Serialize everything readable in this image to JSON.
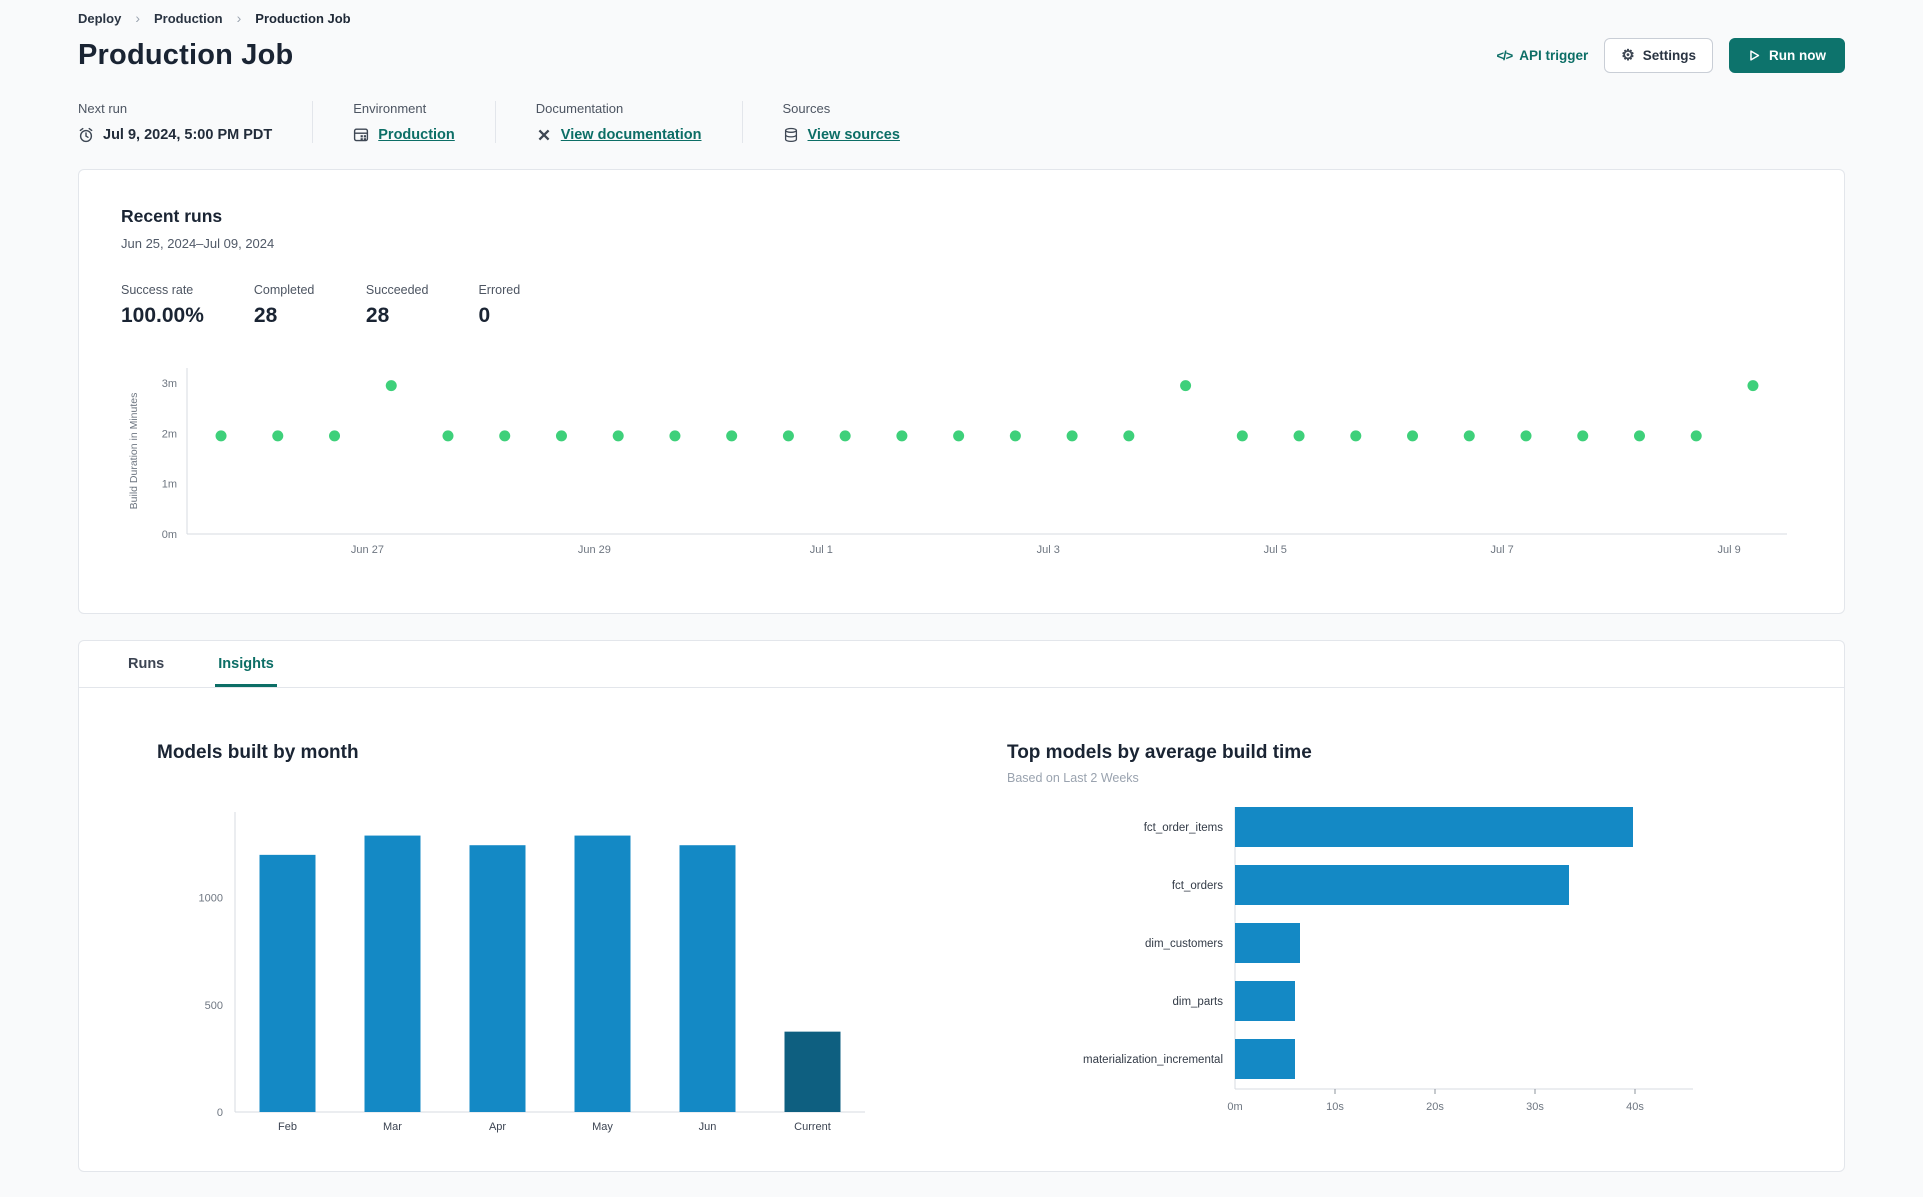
{
  "breadcrumb": {
    "items": [
      {
        "label": "Deploy"
      },
      {
        "label": "Production"
      },
      {
        "label": "Production Job"
      }
    ]
  },
  "header": {
    "title": "Production Job",
    "api_trigger_icon": "</>",
    "api_trigger_label": "API trigger",
    "settings_icon": "⚙",
    "settings_label": "Settings",
    "run_now_label": "Run now"
  },
  "info": {
    "next_run": {
      "label": "Next run",
      "value": "Jul 9, 2024, 5:00 PM PDT",
      "icon": "alarm-clock-icon"
    },
    "environment": {
      "label": "Environment",
      "link": "Production",
      "icon": "environment-icon"
    },
    "documentation": {
      "label": "Documentation",
      "link": "View documentation",
      "icon": "dbt-docs-icon"
    },
    "sources": {
      "label": "Sources",
      "link": "View sources",
      "icon": "database-icon"
    }
  },
  "recent_runs": {
    "title": "Recent runs",
    "date_range": "Jun 25, 2024–Jul 09, 2024",
    "stats": [
      {
        "label": "Success rate",
        "value": "100.00%"
      },
      {
        "label": "Completed",
        "value": "28"
      },
      {
        "label": "Succeeded",
        "value": "28"
      },
      {
        "label": "Errored",
        "value": "0"
      }
    ]
  },
  "tabs": [
    {
      "label": "Runs",
      "active": false
    },
    {
      "label": "Insights",
      "active": true
    }
  ],
  "colors": {
    "accent_teal": "#0c6e66",
    "run_now_bg": "#0d736c",
    "success_green": "#3ed07a",
    "bar_blue": "#1489c5",
    "bar_dark_blue": "#0e5f80"
  },
  "chart_data": [
    {
      "id": "build-duration-scatter",
      "type": "scatter",
      "ylabel": "Build Duration in Minutes",
      "ylim": [
        0,
        3.3
      ],
      "yticks": [
        {
          "label": "0m",
          "value": 0
        },
        {
          "label": "1m",
          "value": 1
        },
        {
          "label": "2m",
          "value": 2
        },
        {
          "label": "3m",
          "value": 3
        }
      ],
      "x_step_days": 0.5,
      "xlim_days": [
        -0.3,
        13.8
      ],
      "xticks": [
        {
          "label": "Jun 27",
          "day": 1.29
        },
        {
          "label": "Jun 29",
          "day": 3.29
        },
        {
          "label": "Jul 1",
          "day": 5.29
        },
        {
          "label": "Jul 3",
          "day": 7.29
        },
        {
          "label": "Jul 5",
          "day": 9.29
        },
        {
          "label": "Jul 7",
          "day": 11.29
        },
        {
          "label": "Jul 9",
          "day": 13.29
        }
      ],
      "durations_minutes": [
        1.95,
        1.95,
        1.95,
        2.95,
        1.95,
        1.95,
        1.95,
        1.95,
        1.95,
        1.95,
        1.95,
        1.95,
        1.95,
        1.95,
        1.95,
        1.95,
        1.95,
        2.95,
        1.95,
        1.95,
        1.95,
        1.95,
        1.95,
        1.95,
        1.95,
        1.95,
        1.95,
        2.95
      ],
      "point_color": "#3ed07a"
    },
    {
      "id": "models-built-by-month",
      "type": "bar",
      "title": "Models built by month",
      "categories": [
        "Feb",
        "Mar",
        "Apr",
        "May",
        "Jun",
        "Current"
      ],
      "values": [
        1200,
        1290,
        1245,
        1290,
        1245,
        375
      ],
      "bar_colors": [
        "#1489c5",
        "#1489c5",
        "#1489c5",
        "#1489c5",
        "#1489c5",
        "#0e5f80"
      ],
      "yticks": [
        0,
        500,
        1000
      ],
      "ylim": [
        0,
        1400
      ],
      "grid": false,
      "legend": false
    },
    {
      "id": "top-models-by-average-build-time",
      "type": "horizontal-bar",
      "title": "Top models by average build time",
      "subtitle": "Based on Last 2 Weeks",
      "categories": [
        "fct_order_items",
        "fct_orders",
        "dim_customers",
        "dim_parts",
        "materialization_incremental"
      ],
      "values_seconds": [
        39.8,
        33.4,
        6.5,
        6.0,
        6.0
      ],
      "xticks": [
        {
          "label": "0m",
          "value": 0
        },
        {
          "label": "10s",
          "value": 10
        },
        {
          "label": "20s",
          "value": 20
        },
        {
          "label": "30s",
          "value": 30
        },
        {
          "label": "40s",
          "value": 40
        }
      ],
      "xlim": [
        0,
        44
      ],
      "bar_color": "#1489c5",
      "grid": false,
      "legend": false
    }
  ]
}
